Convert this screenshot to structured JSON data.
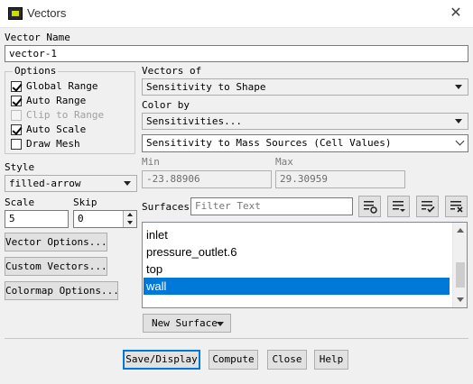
{
  "window": {
    "title": "Vectors"
  },
  "vector_name": {
    "label": "Vector Name",
    "value": "vector-1"
  },
  "options": {
    "legend": "Options",
    "items": [
      {
        "label": "Global Range",
        "checked": true,
        "disabled": false
      },
      {
        "label": "Auto Range",
        "checked": true,
        "disabled": false
      },
      {
        "label": "Clip to Range",
        "checked": false,
        "disabled": true
      },
      {
        "label": "Auto Scale",
        "checked": true,
        "disabled": false
      },
      {
        "label": "Draw Mesh",
        "checked": false,
        "disabled": false
      }
    ]
  },
  "style": {
    "label": "Style",
    "value": "filled-arrow"
  },
  "scale": {
    "label": "Scale",
    "value": "5"
  },
  "skip": {
    "label": "Skip",
    "value": "0"
  },
  "left_buttons": {
    "vector_options": "Vector Options...",
    "custom_vectors": "Custom Vectors...",
    "colormap_options": "Colormap Options..."
  },
  "vectors_of": {
    "label": "Vectors of",
    "value": "Sensitivity to Shape"
  },
  "color_by": {
    "label": "Color by",
    "category": "Sensitivities...",
    "field": "Sensitivity to Mass Sources (Cell Values)"
  },
  "range": {
    "min_label": "Min",
    "min_value": "-23.88906",
    "max_label": "Max",
    "max_value": "29.30959"
  },
  "surfaces": {
    "label": "Surfaces",
    "filter_placeholder": "Filter Text",
    "items": [
      "inlet",
      "pressure_outlet.6",
      "top",
      "wall"
    ],
    "selected": "wall"
  },
  "new_surface": {
    "label": "New Surface"
  },
  "bottom_buttons": {
    "save_display": "Save/Display",
    "compute": "Compute",
    "close": "Close",
    "help": "Help"
  },
  "colors": {
    "selection": "#0078d7",
    "default_button_border": "#0078d7",
    "background": "#f0f0f0"
  }
}
